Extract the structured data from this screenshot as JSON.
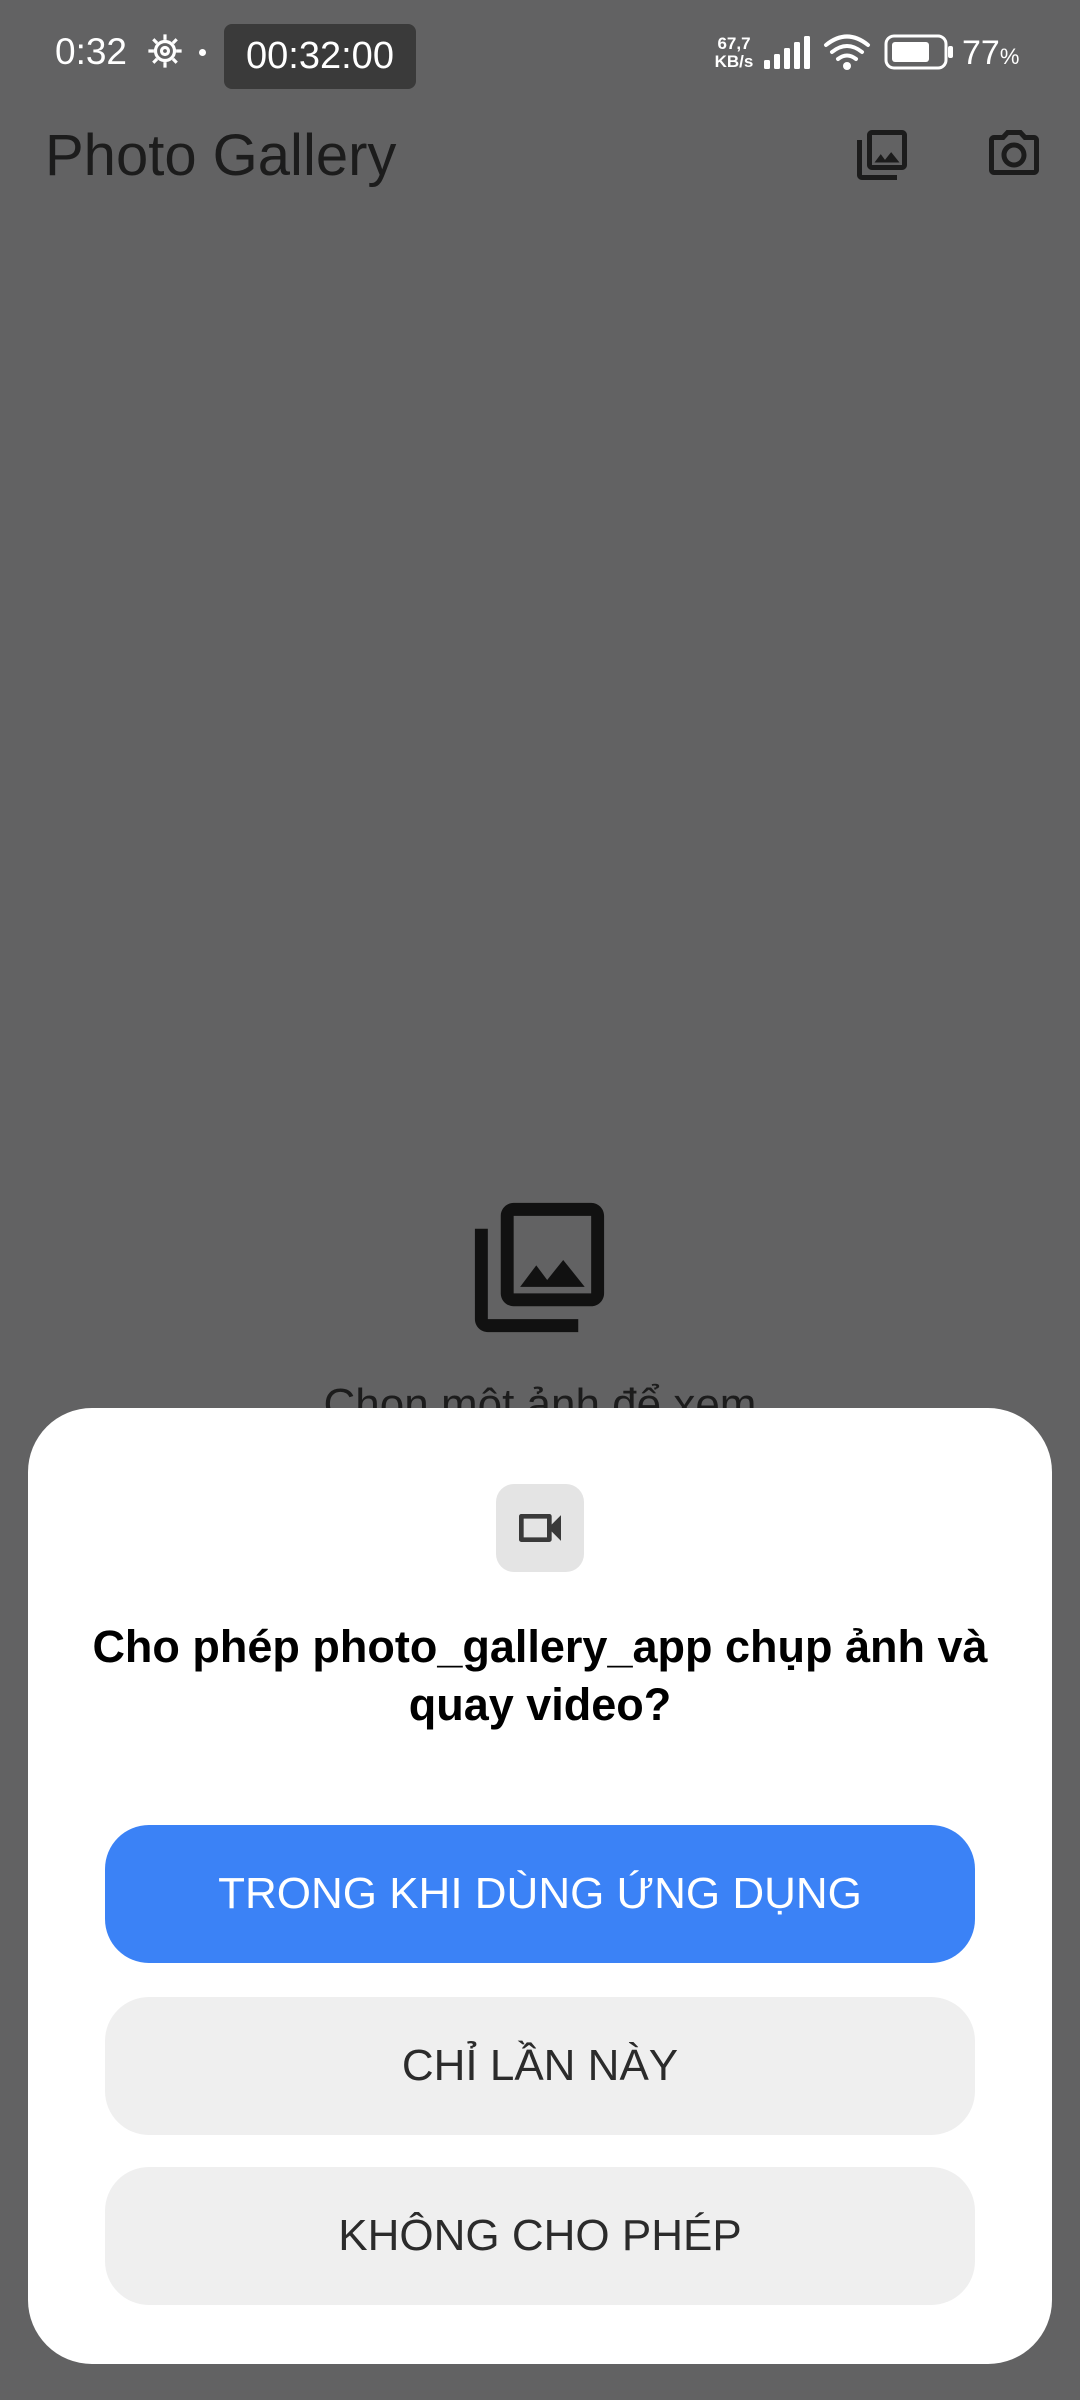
{
  "status_bar": {
    "time": "0:32",
    "timer": "00:32:00",
    "net_speed_value": "67,7",
    "net_speed_unit": "KB/s",
    "battery_percent": "77",
    "battery_unit": "%",
    "battery_level": 0.77,
    "icons": [
      "gear-icon",
      "signal-icon",
      "wifi-icon",
      "battery-icon"
    ]
  },
  "app_bar": {
    "title": "Photo Gallery",
    "actions": [
      "photo-library-icon",
      "camera-icon"
    ]
  },
  "empty_state": {
    "icon": "photo-library-icon",
    "text": "Chọn một ảnh để xem"
  },
  "dialog": {
    "icon": "video-camera-icon",
    "title": "Cho phép photo_gallery_app chụp ảnh và quay video?",
    "buttons": {
      "while_using": "TRONG KHI DÙNG ỨNG DỤNG",
      "only_this_time": "CHỈ LẦN NÀY",
      "deny": "KHÔNG CHO PHÉP"
    }
  },
  "colors": {
    "scrim_background": "#626263",
    "primary_button": "#3b82f6",
    "secondary_button": "#efefef",
    "dialog_background": "#ffffff"
  }
}
